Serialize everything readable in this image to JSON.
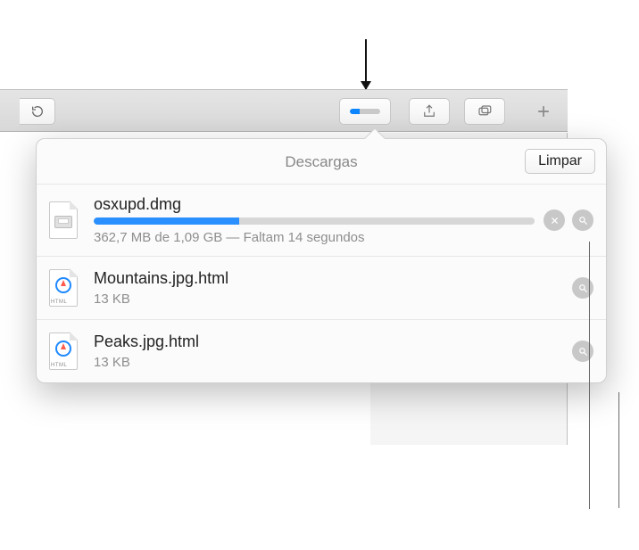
{
  "toolbar": {
    "reload_tooltip": "Recarregar",
    "share_tooltip": "Compartilhar",
    "tabs_tooltip": "Mostrar abas",
    "newtab_tooltip": "Nova aba",
    "downloads_tooltip": "Descargas",
    "download_mini_progress_pct": 33
  },
  "popover": {
    "title": "Descargas",
    "clear_label": "Limpar"
  },
  "downloads": [
    {
      "name": "osxupd.dmg",
      "status": "362,7 MB de 1,09 GB  — Faltam 14 segundos",
      "progress_pct": 33,
      "icon": "dmg",
      "in_progress": true
    },
    {
      "name": "Mountains.jpg.html",
      "status": "13 KB",
      "icon": "html",
      "in_progress": false
    },
    {
      "name": "Peaks.jpg.html",
      "status": "13 KB",
      "icon": "html",
      "in_progress": false
    }
  ],
  "icons": {
    "stop": "stop-icon",
    "reveal": "magnify-icon"
  }
}
